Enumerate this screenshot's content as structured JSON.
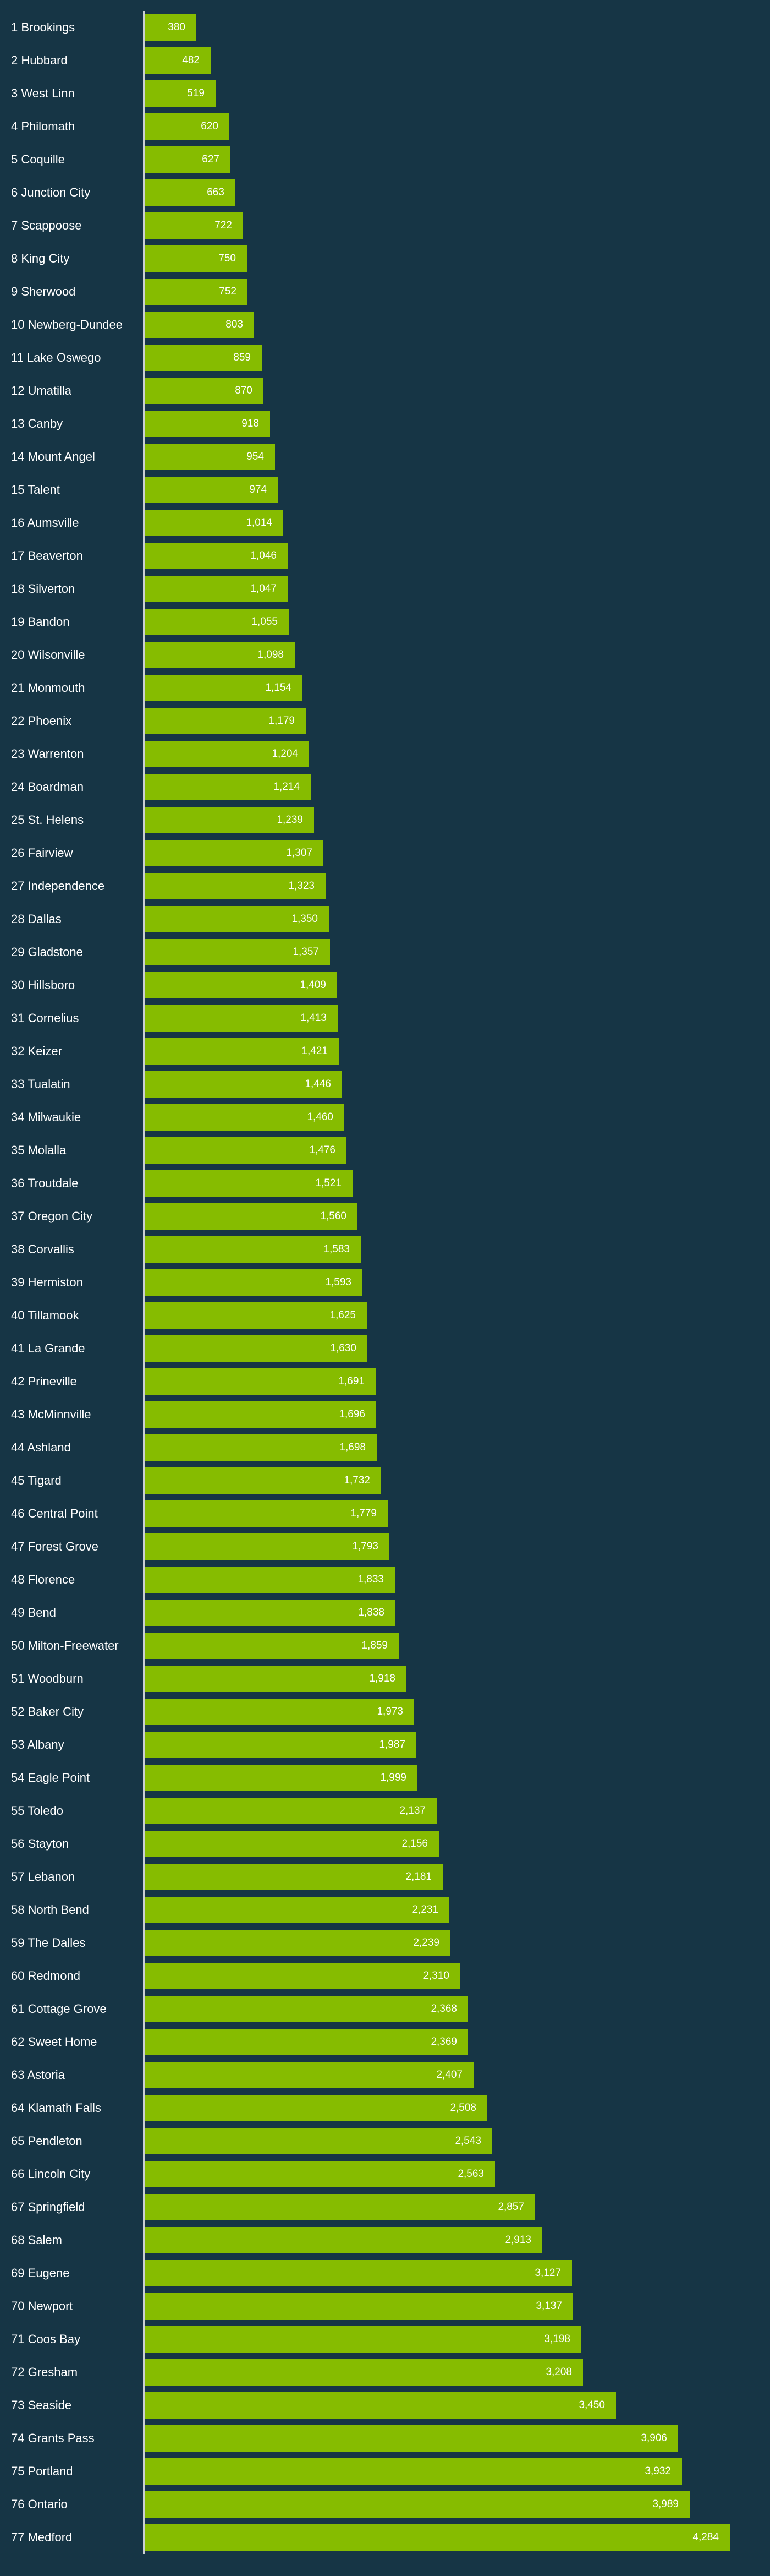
{
  "chart_data": {
    "type": "bar",
    "orientation": "horizontal",
    "title": "",
    "xlabel": "",
    "ylabel": "",
    "xlim": [
      0,
      4284
    ],
    "grid": false,
    "legend": "none",
    "colors": {
      "background": "#163545",
      "bar": "#86bc00",
      "axis": "#c9cfd2",
      "text": "#ffffff"
    },
    "categories": [
      "1 Brookings",
      "2 Hubbard",
      "3 West Linn",
      "4 Philomath",
      "5 Coquille",
      "6 Junction City",
      "7 Scappoose",
      "8 King City",
      "9 Sherwood",
      "10 Newberg-Dundee",
      "11 Lake Oswego",
      "12 Umatilla",
      "13 Canby",
      "14 Mount Angel",
      "15 Talent",
      "16 Aumsville",
      "17 Beaverton",
      "18 Silverton",
      "19 Bandon",
      "20 Wilsonville",
      "21 Monmouth",
      "22 Phoenix",
      "23 Warrenton",
      "24 Boardman",
      "25 St. Helens",
      "26 Fairview",
      "27 Independence",
      "28 Dallas",
      "29 Gladstone",
      "30 Hillsboro",
      "31 Cornelius",
      "32 Keizer",
      "33 Tualatin",
      "34 Milwaukie",
      "35 Molalla",
      "36 Troutdale",
      "37 Oregon City",
      "38 Corvallis",
      "39 Hermiston",
      "40 Tillamook",
      "41 La Grande",
      "42 Prineville",
      "43 McMinnville",
      "44 Ashland",
      "45 Tigard",
      "46 Central Point",
      "47 Forest Grove",
      "48 Florence",
      "49 Bend",
      "50 Milton-Freewater",
      "51 Woodburn",
      "52 Baker City",
      "53 Albany",
      "54 Eagle Point",
      "55 Toledo",
      "56 Stayton",
      "57 Lebanon",
      "58 North Bend",
      "59 The Dalles",
      "60 Redmond",
      "61 Cottage Grove",
      "62 Sweet Home",
      "63 Astoria",
      "64 Klamath Falls",
      "65 Pendleton",
      "66 Lincoln City",
      "67 Springfield",
      "68 Salem",
      "69 Eugene",
      "70 Newport",
      "71 Coos Bay",
      "72 Gresham",
      "73 Seaside",
      "74 Grants Pass",
      "75 Portland",
      "76 Ontario",
      "77 Medford"
    ],
    "values": [
      380,
      482,
      519,
      620,
      627,
      663,
      722,
      750,
      752,
      803,
      859,
      870,
      918,
      954,
      974,
      1014,
      1046,
      1047,
      1055,
      1098,
      1154,
      1179,
      1204,
      1214,
      1239,
      1307,
      1323,
      1350,
      1357,
      1409,
      1413,
      1421,
      1446,
      1460,
      1476,
      1521,
      1560,
      1583,
      1593,
      1625,
      1630,
      1691,
      1696,
      1698,
      1732,
      1779,
      1793,
      1833,
      1838,
      1859,
      1918,
      1973,
      1987,
      1999,
      2137,
      2156,
      2181,
      2231,
      2239,
      2310,
      2368,
      2369,
      2407,
      2508,
      2543,
      2563,
      2857,
      2913,
      3127,
      3137,
      3198,
      3208,
      3450,
      3906,
      3932,
      3989,
      4284
    ],
    "value_labels": [
      "380",
      "482",
      "519",
      "620",
      "627",
      "663",
      "722",
      "750",
      "752",
      "803",
      "859",
      "870",
      "918",
      "954",
      "974",
      "1,014",
      "1,046",
      "1,047",
      "1,055",
      "1,098",
      "1,154",
      "1,179",
      "1,204",
      "1,214",
      "1,239",
      "1,307",
      "1,323",
      "1,350",
      "1,357",
      "1,409",
      "1,413",
      "1,421",
      "1,446",
      "1,460",
      "1,476",
      "1,521",
      "1,560",
      "1,583",
      "1,593",
      "1,625",
      "1,630",
      "1,691",
      "1,696",
      "1,698",
      "1,732",
      "1,779",
      "1,793",
      "1,833",
      "1,838",
      "1,859",
      "1,918",
      "1,973",
      "1,987",
      "1,999",
      "2,137",
      "2,156",
      "2,181",
      "2,231",
      "2,239",
      "2,310",
      "2,368",
      "2,369",
      "2,407",
      "2,508",
      "2,543",
      "2,563",
      "2,857",
      "2,913",
      "3,127",
      "3,137",
      "3,198",
      "3,208",
      "3,450",
      "3,906",
      "3,932",
      "3,989",
      "4,284"
    ]
  }
}
